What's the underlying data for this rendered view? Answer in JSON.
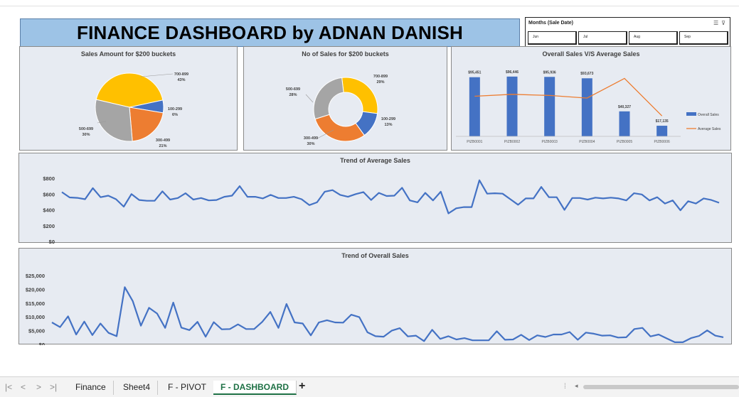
{
  "header": {
    "title": "FINANCE DASHBOARD by ADNAN DANISH"
  },
  "slicer": {
    "title": "Months (Sale Date)",
    "items": [
      "Jun",
      "Jul",
      "Aug",
      "Sep"
    ]
  },
  "tabs": {
    "items": [
      "Finance",
      "Sheet4",
      "F - PIVOT",
      "F - DASHBOARD"
    ],
    "active": "F - DASHBOARD",
    "add": "+"
  },
  "colors": {
    "blue": "#4472c4",
    "orange": "#ed7d31",
    "gray": "#a5a5a5",
    "yellow": "#ffc000",
    "title_bg": "#9dc3e6",
    "panel_bg": "#e7ebf2"
  },
  "chart_data": [
    {
      "type": "pie",
      "title": "Sales Amount for $200 buckets",
      "categories": [
        "700-899",
        "100-299",
        "300-499",
        "500-699"
      ],
      "values": [
        43,
        6,
        21,
        30
      ],
      "labels": [
        "43%",
        "6%",
        "21%",
        "30%"
      ],
      "colors": [
        "#ffc000",
        "#4472c4",
        "#ed7d31",
        "#a5a5a5"
      ]
    },
    {
      "type": "pie",
      "subtype": "doughnut",
      "title": "No of Sales for $200 buckets",
      "categories": [
        "700-899",
        "100-299",
        "300-499",
        "500-699"
      ],
      "values": [
        29,
        13,
        30,
        28
      ],
      "labels": [
        "29%",
        "13%",
        "30%",
        "28%"
      ],
      "colors": [
        "#ffc000",
        "#4472c4",
        "#ed7d31",
        "#a5a5a5"
      ]
    },
    {
      "type": "bar",
      "title": "Overall Sales V/S Average Sales",
      "categories": [
        "PIZB0001",
        "PIZB0002",
        "PIZB0003",
        "PIZB0004",
        "PIZB0005",
        "PIZB0006"
      ],
      "series": [
        {
          "name": "Overall Sales",
          "type": "bar",
          "values": [
            95451,
            96446,
            95936,
            93673,
            40327,
            17135
          ],
          "labels": [
            "$95,451",
            "$96,446",
            "$95,936",
            "$93,673",
            "$40,327",
            "$17,135"
          ],
          "color": "#4472c4"
        },
        {
          "name": "Average Sales",
          "type": "line",
          "values": [
            530,
            555,
            540,
            505,
            765,
            270
          ],
          "color": "#ed7d31"
        }
      ],
      "legend": "right"
    },
    {
      "type": "line",
      "title": "Trend of Average Sales",
      "yticks": [
        "$800",
        "$600",
        "$400",
        "$200",
        "$0"
      ],
      "ylim": [
        0,
        800
      ],
      "series": [
        {
          "name": "Average Sales",
          "color": "#4472c4",
          "values": [
            625,
            557,
            552,
            535,
            675,
            560,
            580,
            535,
            440,
            600,
            525,
            515,
            515,
            635,
            530,
            550,
            610,
            530,
            550,
            520,
            525,
            565,
            580,
            700,
            565,
            565,
            545,
            590,
            550,
            550,
            565,
            535,
            460,
            495,
            630,
            650,
            590,
            565,
            600,
            625,
            525,
            615,
            575,
            580,
            680,
            520,
            495,
            615,
            520,
            630,
            355,
            420,
            435,
            435,
            775,
            605,
            610,
            605,
            535,
            465,
            545,
            545,
            690,
            560,
            560,
            400,
            550,
            550,
            530,
            555,
            545,
            555,
            545,
            520,
            610,
            595,
            520,
            560,
            480,
            520,
            395,
            510,
            480,
            545,
            525,
            490
          ]
        }
      ]
    },
    {
      "type": "line",
      "title": "Trend of Overall Sales",
      "yticks": [
        "$25,000",
        "$20,000",
        "$15,000",
        "$10,000",
        "$5,000",
        "$0"
      ],
      "ylim": [
        0,
        25000
      ],
      "series": [
        {
          "name": "Overall Sales",
          "color": "#4472c4",
          "values": [
            8000,
            6300,
            10200,
            3600,
            8300,
            3400,
            7600,
            4200,
            3000,
            20800,
            15700,
            6800,
            13300,
            11200,
            6000,
            15200,
            6100,
            5200,
            8200,
            2800,
            8100,
            5500,
            5600,
            7300,
            5600,
            5600,
            8200,
            11800,
            6000,
            14700,
            8000,
            7600,
            3300,
            8000,
            8800,
            8000,
            7900,
            10800,
            9900,
            4400,
            3000,
            2800,
            5000,
            5900,
            2900,
            3200,
            1200,
            5300,
            2000,
            3000,
            1800,
            2300,
            1500,
            1500,
            1500,
            4800,
            1700,
            1800,
            3500,
            1600,
            3300,
            2700,
            3600,
            3600,
            4500,
            1700,
            4300,
            3900,
            3200,
            3300,
            2500,
            2600,
            5600,
            6000,
            2900,
            3600,
            2200,
            800,
            800,
            2300,
            3100,
            5100,
            3200,
            2600
          ]
        }
      ]
    }
  ]
}
